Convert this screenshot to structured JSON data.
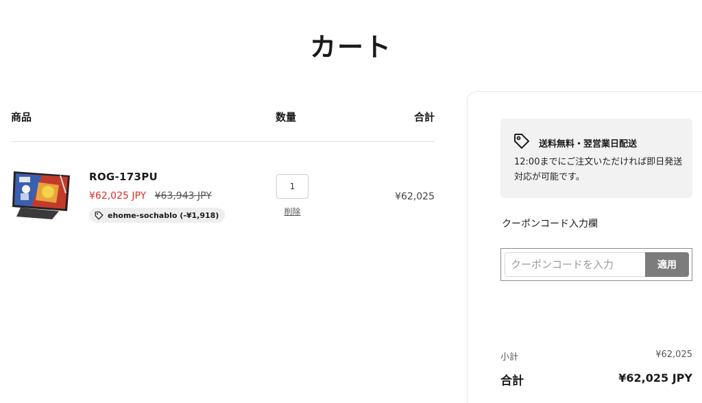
{
  "page": {
    "title": "カート"
  },
  "cart": {
    "headers": {
      "product": "商品",
      "quantity": "数量",
      "total": "合計"
    },
    "items": [
      {
        "name": "ROG-173PU",
        "sale_price": "¥62,025 JPY",
        "compare_price": "¥63,943 JPY",
        "discount": "ehome-sochablo (-¥1,918)",
        "quantity": "1",
        "remove_label": "削除",
        "line_total": "¥62,025",
        "image_icon": "portable-monitor-image"
      }
    ]
  },
  "summary": {
    "shipping": {
      "icon": "tag-icon",
      "title": "送料無料・翌営業日配送",
      "body": "12:00までにご注文いただければ即日発送対応が可能です。"
    },
    "coupon": {
      "label": "クーポンコード入力欄",
      "placeholder": "クーポンコードを入力",
      "value": "",
      "apply_label": "適用"
    },
    "subtotal_label": "小計",
    "subtotal_value": "¥62,025",
    "total_label": "合計",
    "total_value": "¥62,025 JPY"
  },
  "colors": {
    "sale_price": "#e02b27",
    "apply_button": "#7c7c7c",
    "shipping_box_bg": "#f2f2f2",
    "badge_bg": "#eeeeee"
  }
}
